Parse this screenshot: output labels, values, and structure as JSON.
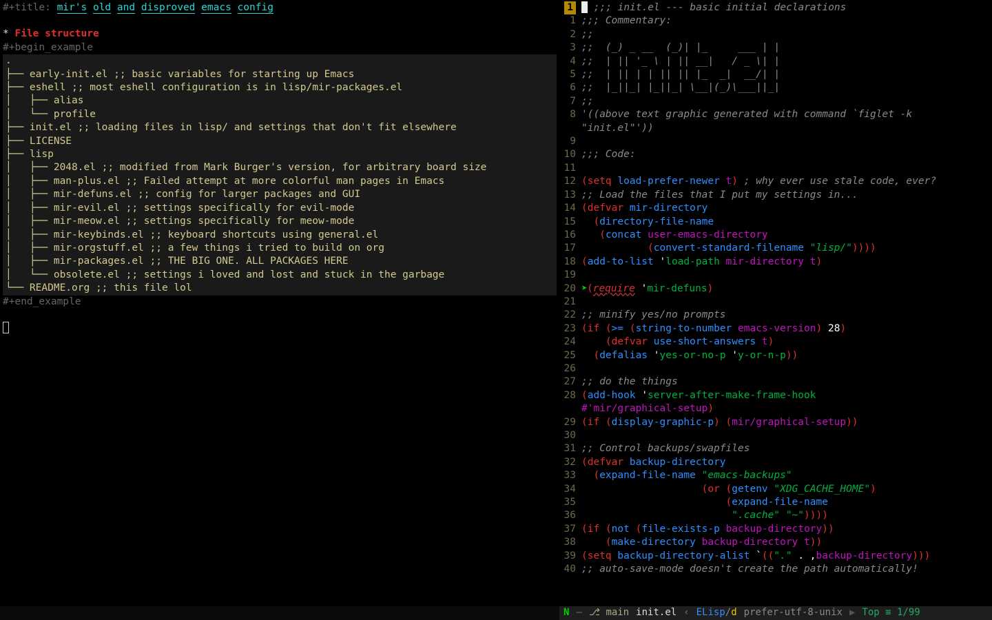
{
  "left": {
    "title_meta": "#+title: ",
    "title_words": [
      "mir's",
      "old",
      "and",
      "disproved",
      "emacs",
      "config"
    ],
    "heading": "File structure",
    "begin": "#+begin_example",
    "end": "#+end_example",
    "tree": [
      ".",
      "├── early-init.el ;; basic variables for starting up Emacs",
      "├── eshell ;; most eshell configuration is in lisp/mir-packages.el",
      "│   ├── alias",
      "│   └── profile",
      "├── init.el ;; loading files in lisp/ and settings that don't fit elsewhere",
      "├── LICENSE",
      "├── lisp",
      "│   ├── 2048.el ;; modified from Mark Burger's version, for arbitrary board size",
      "│   ├── man-plus.el ;; Failed attempt at more colorful man pages in Emacs",
      "│   ├── mir-defuns.el ;; config for larger packages and GUI",
      "│   ├── mir-evil.el ;; settings specifically for evil-mode",
      "│   ├── mir-meow.el ;; settings specifically for meow-mode",
      "│   ├── mir-keybinds.el ;; keyboard shortcuts using general.el",
      "│   ├── mir-orgstuff.el ;; a few things i tried to build on org",
      "│   ├── mir-packages.el ;; THE BIG ONE. ALL PACKAGES HERE",
      "│   └── obsolete.el ;; settings i loved and lost and stuck in the garbage",
      "└── README.org ;; this file lol"
    ]
  },
  "right_top_number": "1",
  "right_lines": [
    {
      "n": "",
      "html": "<span class='comment'>;;; init.el --- basic initial declarations</span>"
    },
    {
      "n": "1",
      "html": "<span class='comment'>;;; Commentary:</span>"
    },
    {
      "n": "2",
      "html": "<span class='comment'>;;</span>"
    },
    {
      "n": "3",
      "html": "<span class='comment'>;;  (_) _ __  (_)| |_     ___ | |</span>"
    },
    {
      "n": "4",
      "html": "<span class='comment'>;;  | || '_ \\ | || __|   / _ \\| |</span>"
    },
    {
      "n": "5",
      "html": "<span class='comment'>;;  | || | | || || |_  _|  __/| |</span>"
    },
    {
      "n": "6",
      "html": "<span class='comment'>;;  |_||_| |_||_| \\__|(_)\\___||_|</span>"
    },
    {
      "n": "7",
      "html": "<span class='comment'>;;</span>"
    },
    {
      "n": "8",
      "html": "<span class='comment'>'((above text graphic generated with command `figlet -k \"init.el\"'))</span>",
      "wrap": true
    },
    {
      "n": "9",
      "html": ""
    },
    {
      "n": "10",
      "html": "<span class='comment'>;;; Code:</span>"
    },
    {
      "n": "11",
      "html": ""
    },
    {
      "n": "12",
      "html": "<span class='paren'>(</span><span class='kw'>setq</span> <span class='fn'>load-prefer-newer</span> <span class='magenta'>t</span><span class='paren'>)</span> <span class='comment'>; why ever use stale code, ever?</span>"
    },
    {
      "n": "13",
      "html": "<span class='comment'>;; Load the files that I put my settings in...</span>"
    },
    {
      "n": "14",
      "html": "<span class='paren'>(</span><span class='kw'>defvar</span> <span class='fn'>mir-directory</span>"
    },
    {
      "n": "15",
      "html": "  <span class='paren'>(</span><span class='fn'>directory-file-name</span>"
    },
    {
      "n": "16",
      "html": "   <span class='paren'>(</span><span class='fn'>concat</span> <span class='magenta'>user-emacs-directory</span>"
    },
    {
      "n": "17",
      "html": "           <span class='paren'>(</span><span class='fn'>convert-standard-filename</span> <span class='str'>\"lisp/\"</span><span class='paren'>))))</span>"
    },
    {
      "n": "18",
      "html": "<span class='paren'>(</span><span class='fn'>add-to-list</span> <span class='quote'>'</span><span class='sym'>load-path</span> <span class='magenta'>mir-directory</span> <span class='magenta'>t</span><span class='paren'>)</span>"
    },
    {
      "n": "19",
      "html": ""
    },
    {
      "n": "20",
      "html": "<span class='paren'>(</span><span class='redvar ul'>require</span> <span class='quote'>'</span><span class='sym'>mir-defuns</span><span class='paren'>)</span>",
      "arrow": true
    },
    {
      "n": "21",
      "html": ""
    },
    {
      "n": "22",
      "html": "<span class='comment'>;; minify yes/no prompts</span>"
    },
    {
      "n": "23",
      "html": "<span class='paren'>(</span><span class='kw'>if</span> <span class='paren'>(</span><span class='fn'>&gt;=</span> <span class='paren'>(</span><span class='fn'>string-to-number</span> <span class='magenta'>emacs-version</span><span class='paren'>)</span> <span class='num'>28</span><span class='paren'>)</span>"
    },
    {
      "n": "24",
      "html": "    <span class='paren'>(</span><span class='kw'>defvar</span> <span class='fn'>use-short-answers</span> <span class='magenta'>t</span><span class='paren'>)</span>"
    },
    {
      "n": "25",
      "html": "  <span class='paren'>(</span><span class='fn'>defalias</span> <span class='quote'>'</span><span class='sym'>yes-or-no-p</span> <span class='quote'>'</span><span class='sym'>y-or-n-p</span><span class='paren'>))</span>"
    },
    {
      "n": "26",
      "html": ""
    },
    {
      "n": "27",
      "html": "<span class='comment'>;; do the things</span>"
    },
    {
      "n": "28",
      "html": "<span class='paren'>(</span><span class='fn'>add-hook</span> <span class='quote'>'</span><span class='sym'>server-after-make-frame-hook</span> <span class='magenta'>#'mir/graphical-setup</span><span class='paren'>)</span>",
      "wrap28": true
    },
    {
      "n": "29",
      "html": "<span class='paren'>(</span><span class='kw'>if</span> <span class='paren'>(</span><span class='fn'>display-graphic-p</span><span class='paren'>)</span> <span class='paren'>(</span><span class='magenta'>mir/graphical-setup</span><span class='paren'>))</span>"
    },
    {
      "n": "30",
      "html": ""
    },
    {
      "n": "31",
      "html": "<span class='comment'>;; Control backups/swapfiles</span>"
    },
    {
      "n": "32",
      "html": "<span class='paren'>(</span><span class='kw'>defvar</span> <span class='fn'>backup-directory</span>"
    },
    {
      "n": "33",
      "html": "  <span class='paren'>(</span><span class='fn'>expand-file-name</span> <span class='str'>\"emacs-backups\"</span>"
    },
    {
      "n": "34",
      "html": "                    <span class='paren'>(</span><span class='kw'>or</span> <span class='paren'>(</span><span class='fn'>getenv</span> <span class='str'>\"XDG_CACHE_HOME\"</span><span class='paren'>)</span>"
    },
    {
      "n": "35",
      "html": "                        <span class='paren'>(</span><span class='fn'>expand-file-name</span>"
    },
    {
      "n": "36",
      "html": "                         <span class='str'>\".cache\"</span> <span class='str'>\"~\"</span><span class='paren'>))))</span>"
    },
    {
      "n": "37",
      "html": "<span class='paren'>(</span><span class='kw'>if</span> <span class='paren'>(</span><span class='fn'>not</span> <span class='paren'>(</span><span class='fn'>file-exists-p</span> <span class='magenta'>backup-directory</span><span class='paren'>))</span>"
    },
    {
      "n": "38",
      "html": "    <span class='paren'>(</span><span class='fn'>make-directory</span> <span class='magenta'>backup-directory</span> <span class='magenta'>t</span><span class='paren'>))</span>"
    },
    {
      "n": "39",
      "html": "<span class='paren'>(</span><span class='kw'>setq</span> <span class='fn'>backup-directory-alist</span> <span class='quote'>`</span><span class='paren'>((</span><span class='str'>\".\"</span> <span class='quote'>. ,</span><span class='magenta'>backup-directory</span><span class='paren'>)))</span>"
    },
    {
      "n": "40",
      "html": "<span class='comment'>;; auto-save-mode doesn't create the path automatically!</span>"
    }
  ],
  "mode_right": {
    "state": "N",
    "branch_icon": "⎇",
    "branch": "main",
    "file": "init.el",
    "major": "ELisp",
    "diag": "d",
    "coding": "prefer-utf-8-unix",
    "pos": "Top ≡ 1/99"
  }
}
